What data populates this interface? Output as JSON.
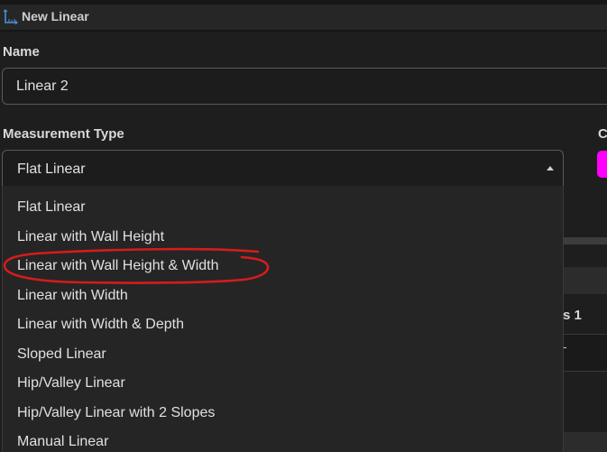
{
  "window": {
    "title": "New Linear"
  },
  "name_field": {
    "label": "Name",
    "value": "Linear 2"
  },
  "measurement_type": {
    "label": "Measurement Type",
    "selected": "Flat Linear",
    "options": [
      "Flat Linear",
      "Linear with Wall Height",
      "Linear with Wall Height & Width",
      "Linear with Width",
      "Linear with Width & Depth",
      "Sloped Linear",
      "Hip/Valley Linear",
      "Hip/Valley Linear with 2 Slopes",
      "Manual Linear"
    ],
    "highlighted_option": "Linear with Wall Height & Width"
  },
  "color": {
    "label_visible": "C",
    "swatch": "#ff00ff"
  },
  "peek": {
    "partial_label": "s 1",
    "partial_value": "-"
  },
  "colors": {
    "background": "#1e1e1e",
    "annotation": "#d41c1c",
    "icon": "#4a90d9"
  },
  "icons": {
    "title": "linear-measure-icon",
    "caret": "caret-up-icon"
  }
}
